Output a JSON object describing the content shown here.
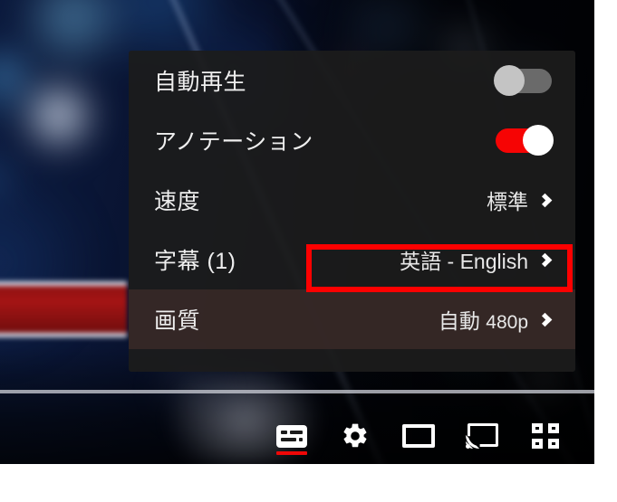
{
  "player": {
    "progress_bar": {
      "name": "video-progress-bar"
    },
    "controls": [
      {
        "id": "subtitles-button",
        "icon": "closed-captions-icon",
        "active": true,
        "label": "字幕"
      },
      {
        "id": "settings-button",
        "icon": "gear-icon",
        "active": false,
        "label": "設定"
      },
      {
        "id": "theater-button",
        "icon": "theater-mode-icon",
        "active": false,
        "label": "シアターモード"
      },
      {
        "id": "cast-button",
        "icon": "cast-icon",
        "active": false,
        "label": "キャスト"
      },
      {
        "id": "fullscreen-button",
        "icon": "fullscreen-icon",
        "active": false,
        "label": "全画面"
      }
    ]
  },
  "settings_menu": {
    "rows": [
      {
        "label": "自動再生",
        "type": "toggle",
        "toggle_state": "off",
        "value": "",
        "value_sub": ""
      },
      {
        "label": "アノテーション",
        "type": "toggle",
        "toggle_state": "on",
        "value": "",
        "value_sub": ""
      },
      {
        "label": "速度",
        "type": "submenu",
        "value": "標準",
        "value_sub": ""
      },
      {
        "label": "字幕 (1)",
        "type": "submenu",
        "value": "英語 - English",
        "value_sub": ""
      },
      {
        "label": "画質",
        "type": "submenu",
        "value": "自動",
        "value_sub": "480p"
      }
    ],
    "highlighted_row_index": 3,
    "hovered_row_index": 4
  },
  "colors": {
    "accent_red": "#f60404",
    "annotation_red": "#fe0000",
    "panel_background": "#1c1c1c",
    "toggle_off_track": "#6a6a6a",
    "toggle_off_knob": "#c4c4c4"
  }
}
